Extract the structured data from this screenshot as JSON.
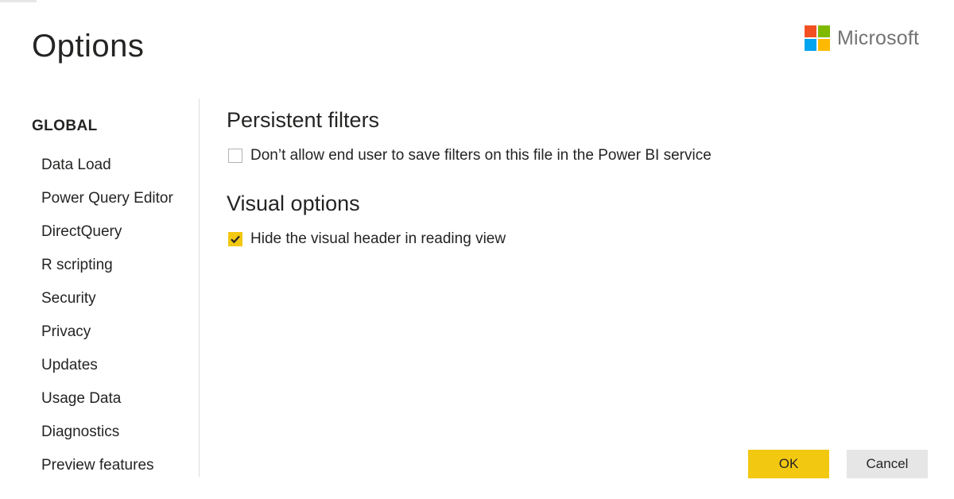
{
  "dialog": {
    "title": "Options"
  },
  "brand": {
    "name": "Microsoft",
    "logo_colors": [
      "#f25022",
      "#7fba00",
      "#00a4ef",
      "#ffb900"
    ]
  },
  "sidebar": {
    "heading": "GLOBAL",
    "items": [
      {
        "label": "Data Load"
      },
      {
        "label": "Power Query Editor"
      },
      {
        "label": "DirectQuery"
      },
      {
        "label": "R scripting"
      },
      {
        "label": "Security"
      },
      {
        "label": "Privacy"
      },
      {
        "label": "Updates"
      },
      {
        "label": "Usage Data"
      },
      {
        "label": "Diagnostics"
      },
      {
        "label": "Preview features"
      }
    ]
  },
  "main": {
    "sections": [
      {
        "title": "Persistent filters",
        "option": {
          "label": "Don’t allow end user to save filters on this file in the Power BI service",
          "checked": false
        }
      },
      {
        "title": "Visual options",
        "option": {
          "label": "Hide the visual header in reading view",
          "checked": true
        }
      }
    ]
  },
  "footer": {
    "ok_label": "OK",
    "cancel_label": "Cancel"
  },
  "colors": {
    "accent": "#f2c811",
    "cancel_bg": "#e6e6e6",
    "text": "#252423",
    "checkmark": "#252423"
  },
  "icons": {
    "logo": "microsoft-logo",
    "checkmark": "check-icon"
  }
}
